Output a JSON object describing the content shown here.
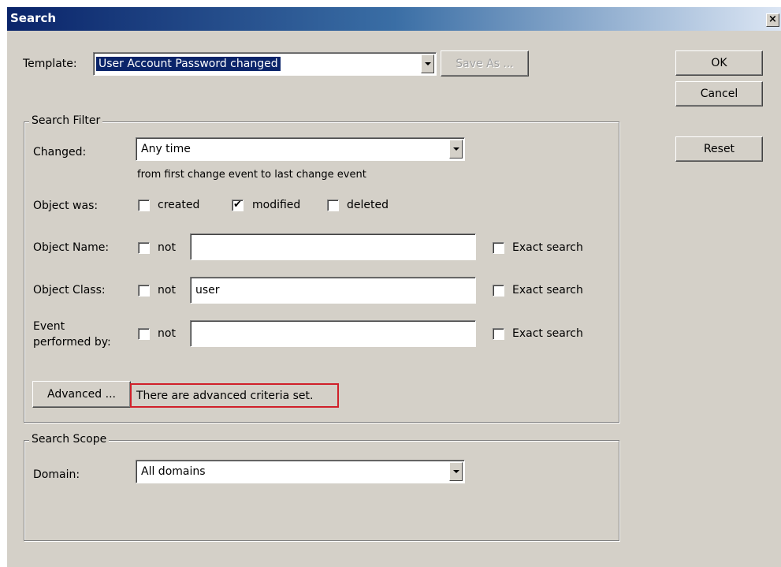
{
  "window": {
    "title": "Search",
    "close_glyph": "×"
  },
  "template": {
    "label": "Template:",
    "value": "User Account Password changed",
    "save_as_label": "Save As ..."
  },
  "buttons": {
    "ok": "OK",
    "cancel": "Cancel",
    "reset": "Reset"
  },
  "search_filter": {
    "title": "Search Filter",
    "changed": {
      "label": "Changed:",
      "value": "Any time",
      "hint": "from first change event to last change event"
    },
    "object_was": {
      "label": "Object was:",
      "options": [
        {
          "label": "created",
          "checked": false
        },
        {
          "label": "modified",
          "checked": true
        },
        {
          "label": "deleted",
          "checked": false
        }
      ]
    },
    "object_name": {
      "label": "Object Name:",
      "not_label": "not",
      "value": "",
      "exact_label": "Exact search"
    },
    "object_class": {
      "label": "Object Class:",
      "not_label": "not",
      "value": "user",
      "exact_label": "Exact search"
    },
    "performed_by": {
      "label_line1": "Event",
      "label_line2": "performed by:",
      "not_label": "not",
      "value": "",
      "exact_label": "Exact search"
    },
    "advanced": {
      "button_label": "Advanced ...",
      "status": "There are advanced criteria set."
    }
  },
  "search_scope": {
    "title": "Search Scope",
    "domain": {
      "label": "Domain:",
      "value": "All domains"
    }
  },
  "glyphs": {
    "checkmark": "✔"
  },
  "colors": {
    "dialog_bg": "#d4d0c8",
    "title_bar_start": "#0a246a",
    "highlight_border": "#d0202a",
    "selection_bg": "#0a246a"
  }
}
